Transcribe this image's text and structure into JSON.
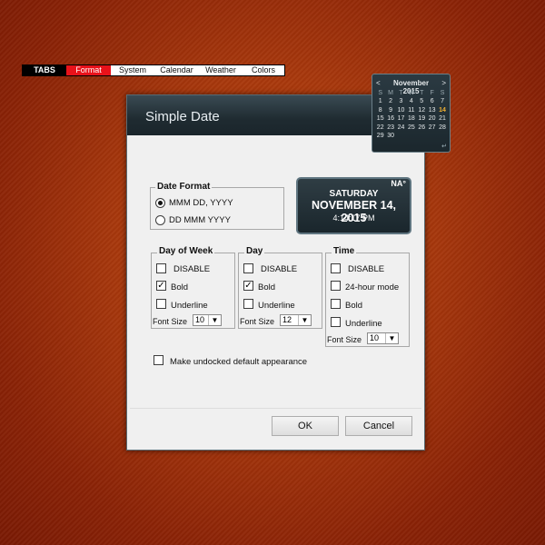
{
  "dialog": {
    "title": "Simple Date",
    "tabs": [
      "TABS",
      "Format",
      "System",
      "Calendar",
      "Weather",
      "Colors"
    ],
    "date_format": {
      "legend": "Date Format",
      "options": [
        "MMM DD, YYYY",
        "DD MMM YYYY"
      ],
      "selected": "MMM DD, YYYY"
    },
    "preview": {
      "badge": "NA°",
      "day": "SATURDAY",
      "date": "NOVEMBER 14, 2015",
      "time": "4:14:17 PM"
    },
    "day_of_week": {
      "legend": "Day of Week",
      "disable": "DISABLE",
      "bold": "Bold",
      "underline": "Underline",
      "font_size_label": "Font Size",
      "font_size": "10"
    },
    "day": {
      "legend": "Day",
      "disable": "DISABLE",
      "bold": "Bold",
      "underline": "Underline",
      "font_size_label": "Font Size",
      "font_size": "12"
    },
    "time": {
      "legend": "Time",
      "disable": "DISABLE",
      "mode": "24-hour mode",
      "bold": "Bold",
      "underline": "Underline",
      "font_size_label": "Font Size",
      "font_size": "10"
    },
    "undocked_label": "Make undocked default appearance",
    "ok_label": "OK",
    "cancel_label": "Cancel",
    "check_mark": "✓"
  },
  "calendar": {
    "month": "November 2015",
    "prev": "<",
    "next": ">",
    "weekdays": [
      "S",
      "M",
      "T",
      "W",
      "T",
      "F",
      "S"
    ],
    "weeks": [
      [
        "1",
        "2",
        "3",
        "4",
        "5",
        "6",
        "7"
      ],
      [
        "8",
        "9",
        "10",
        "11",
        "12",
        "13",
        "14"
      ],
      [
        "15",
        "16",
        "17",
        "18",
        "19",
        "20",
        "21"
      ],
      [
        "22",
        "23",
        "24",
        "25",
        "26",
        "27",
        "28"
      ],
      [
        "29",
        "30",
        "",
        "",
        "",
        "",
        ""
      ]
    ],
    "today": "14",
    "return_glyph": "↵"
  },
  "colors": {
    "accent_tab": "#e8121a",
    "today": "#f2b233"
  }
}
